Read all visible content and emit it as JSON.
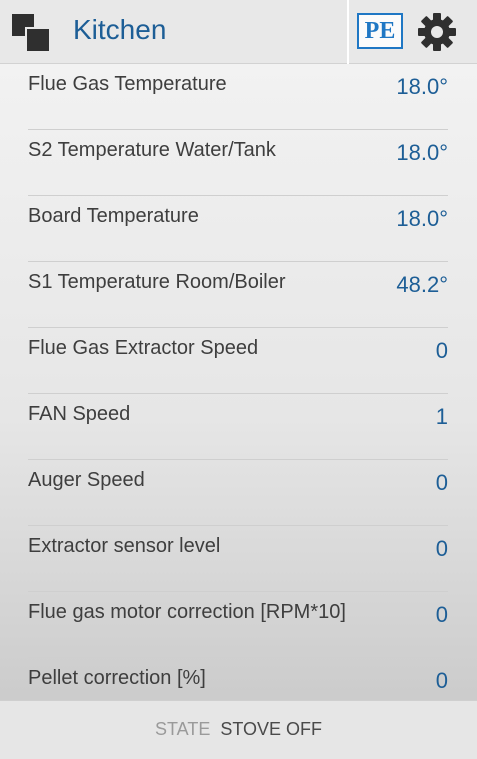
{
  "header": {
    "title": "Kitchen",
    "logo_text": "PE",
    "menu_icon": "windows-icon",
    "settings_icon": "gear-icon"
  },
  "readings": [
    {
      "label": "Flue Gas Temperature",
      "value": "18.0°"
    },
    {
      "label": "S2 Temperature Water/Tank",
      "value": "18.0°"
    },
    {
      "label": "Board Temperature",
      "value": "18.0°"
    },
    {
      "label": "S1 Temperature Room/Boiler",
      "value": "48.2°"
    },
    {
      "label": "Flue Gas Extractor Speed",
      "value": "0"
    },
    {
      "label": "FAN Speed",
      "value": "1"
    },
    {
      "label": "Auger Speed",
      "value": "0"
    },
    {
      "label": "Extractor sensor level",
      "value": "0"
    },
    {
      "label": "Flue gas motor correction [RPM*10]",
      "value": "0"
    },
    {
      "label": "Pellet correction [%]",
      "value": "0"
    }
  ],
  "footer": {
    "state_label": "STATE",
    "state_value": "STOVE OFF"
  },
  "colors": {
    "accent": "#1d5e96",
    "logo": "#1f77c4",
    "label_text": "#3e3e3e",
    "muted_text": "#9a9a9a"
  }
}
